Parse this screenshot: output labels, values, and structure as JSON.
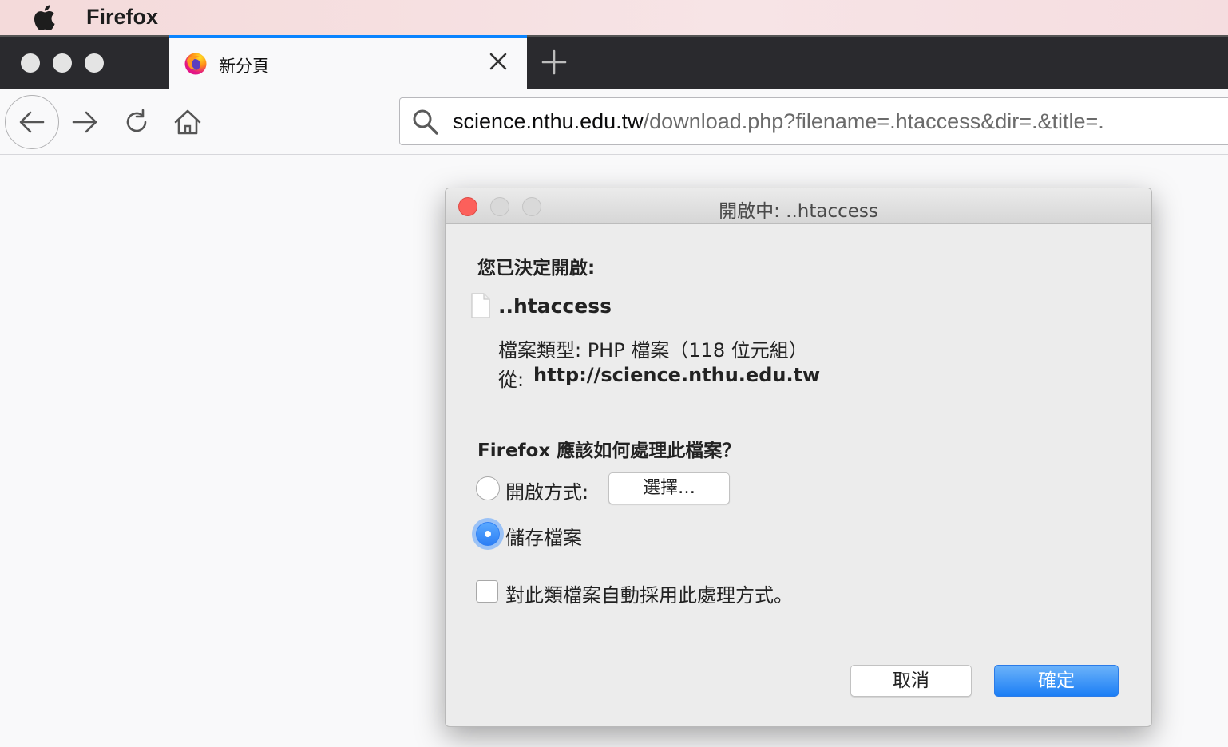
{
  "menubar": {
    "apple_icon": "apple-logo-icon",
    "app_name": "Firefox",
    "background": "#f4dada"
  },
  "browser": {
    "tab": {
      "title": "新分頁",
      "favicon": "firefox-logo-icon",
      "accent": "#0a84ff"
    },
    "new_tab_icon": "plus-icon",
    "nav": {
      "back_icon": "arrow-left-icon",
      "forward_icon": "arrow-right-icon",
      "reload_icon": "reload-icon",
      "home_icon": "home-icon"
    },
    "urlbar": {
      "host": "science.nthu.edu.tw",
      "path": "/download.php?filename=.htaccess&dir=.&title=."
    }
  },
  "dialog": {
    "title": "開啟中: ..htaccess",
    "decided_heading": "您已決定開啟:",
    "filename": "..htaccess",
    "filetype": "檔案類型: PHP 檔案（118 位元組）",
    "from_label": "從:",
    "from_url": "http://science.nthu.edu.tw",
    "question": "Firefox 應該如何處理此檔案？",
    "open_with_label": "開啟方式:",
    "choose_button": "選擇…",
    "save_file_label": "儲存檔案",
    "selected_option": "save_file",
    "auto_label": "對此類檔案自動採用此處理方式。",
    "auto_checked": false,
    "cancel_button": "取消",
    "ok_button": "確定",
    "ok_color": "#1b7ef5"
  }
}
